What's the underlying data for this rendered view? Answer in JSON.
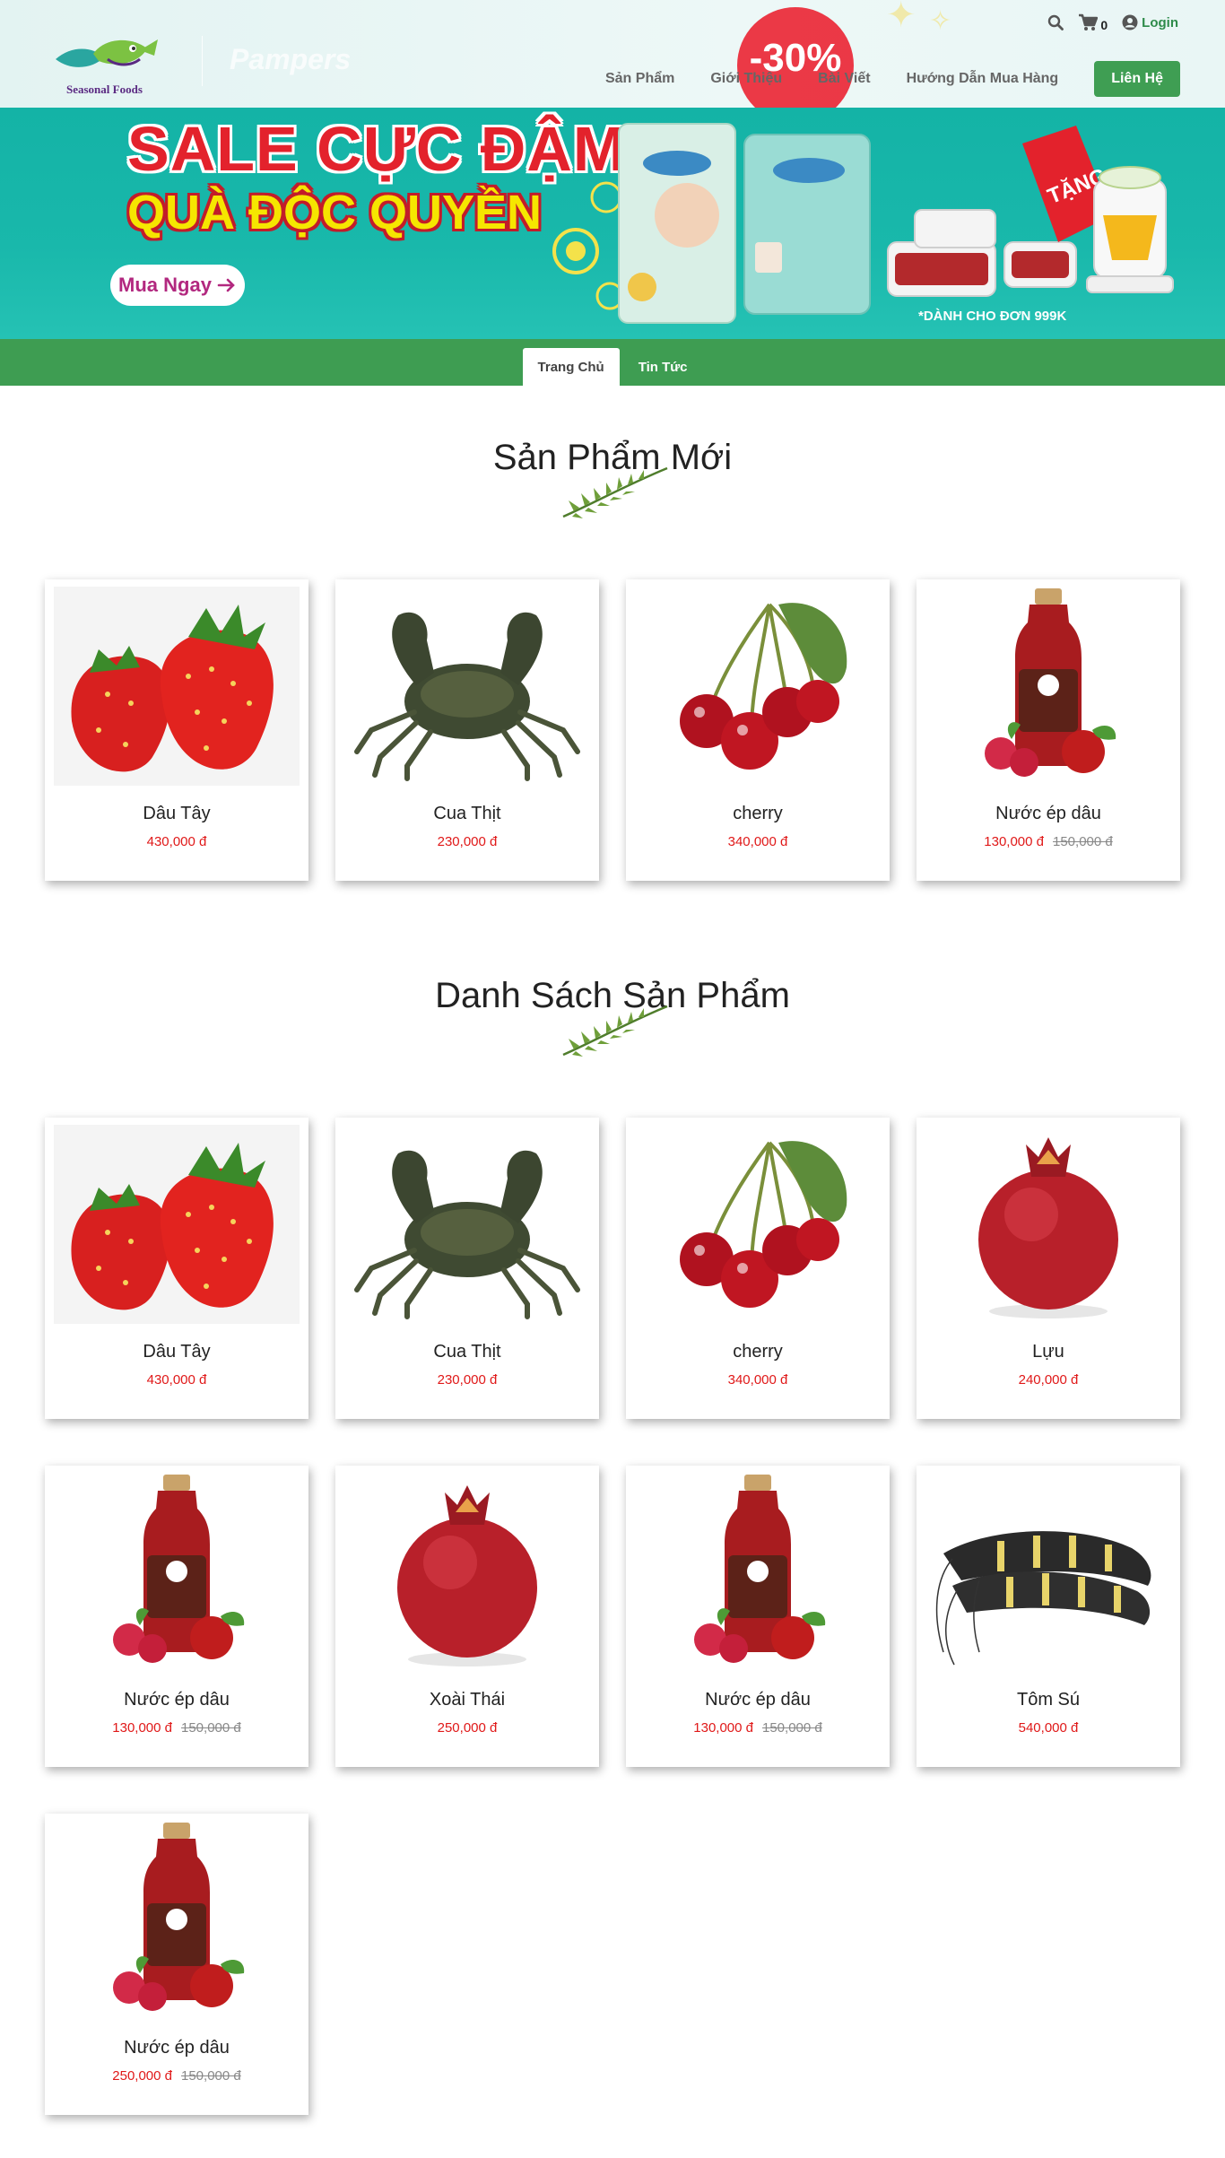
{
  "brand": {
    "logo_text": "Seasonal Foods",
    "ghost_brand": "Pampers",
    "ghost_badge": "-30%"
  },
  "top_icons": {
    "search_icon": "search-icon",
    "cart_icon": "cart-icon",
    "cart_count": "0",
    "login_label": "Login"
  },
  "nav": {
    "items": [
      "Sản Phẩm",
      "Giới Thiệu",
      "Bài Viết",
      "Hướng Dẫn Mua Hàng"
    ],
    "contact_label": "Liên Hệ"
  },
  "banner": {
    "line1": "SALE CỰC ĐẬM",
    "line2": "QUÀ ĐỘC QUYỀN",
    "button_label": "Mua Ngay",
    "note": "*DÀNH CHO ĐƠN 999K",
    "colors": {
      "background": "#14b3a6",
      "headline": "#e3222c",
      "subline": "#f6e600",
      "button_text": "#b2287f"
    }
  },
  "tabs": [
    {
      "label": "Trang Chủ",
      "active": true
    },
    {
      "label": "Tin Tức",
      "active": false
    }
  ],
  "colors": {
    "accent_green": "#3e9d52",
    "price_red": "#e01818"
  },
  "new_products": {
    "title": "Sản Phẩm Mới",
    "items": [
      {
        "name": "Dâu Tây",
        "price": "430,000 đ",
        "old_price": "",
        "image": "strawberry"
      },
      {
        "name": "Cua Thịt",
        "price": "230,000 đ",
        "old_price": "",
        "image": "crab"
      },
      {
        "name": "cherry",
        "price": "340,000 đ",
        "old_price": "",
        "image": "cherry"
      },
      {
        "name": "Nước ép dâu",
        "price": "130,000 đ",
        "old_price": "150,000 đ",
        "image": "juice"
      }
    ]
  },
  "product_list": {
    "title": "Danh Sách Sản Phẩm",
    "items": [
      {
        "name": "Dâu Tây",
        "price": "430,000 đ",
        "old_price": "",
        "image": "strawberry"
      },
      {
        "name": "Cua Thịt",
        "price": "230,000 đ",
        "old_price": "",
        "image": "crab"
      },
      {
        "name": "cherry",
        "price": "340,000 đ",
        "old_price": "",
        "image": "cherry"
      },
      {
        "name": "Lựu",
        "price": "240,000 đ",
        "old_price": "",
        "image": "pomegranate"
      },
      {
        "name": "Nước ép dâu",
        "price": "130,000 đ",
        "old_price": "150,000 đ",
        "image": "juice"
      },
      {
        "name": "Xoài Thái",
        "price": "250,000 đ",
        "old_price": "",
        "image": "pomegranate"
      },
      {
        "name": "Nước ép dâu",
        "price": "130,000 đ",
        "old_price": "150,000 đ",
        "image": "juice"
      },
      {
        "name": "Tôm Sú",
        "price": "540,000 đ",
        "old_price": "",
        "image": "shrimp"
      },
      {
        "name": "Nước ép dâu",
        "price": "250,000 đ",
        "old_price": "150,000 đ",
        "image": "juice"
      }
    ]
  }
}
